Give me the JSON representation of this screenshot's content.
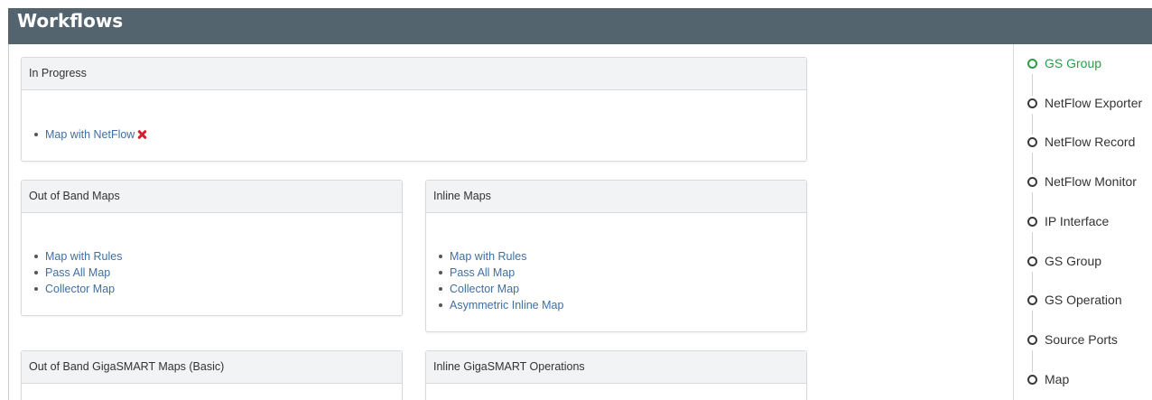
{
  "header": {
    "title": "Workflows"
  },
  "panels": {
    "in_progress": {
      "title": "In Progress",
      "items": [
        {
          "label": "Map with NetFlow",
          "removable": true
        }
      ]
    },
    "out_of_band_maps": {
      "title": "Out of Band Maps",
      "items": [
        {
          "label": "Map with Rules"
        },
        {
          "label": "Pass All Map"
        },
        {
          "label": "Collector Map"
        }
      ]
    },
    "inline_maps": {
      "title": "Inline Maps",
      "items": [
        {
          "label": "Map with Rules"
        },
        {
          "label": "Pass All Map"
        },
        {
          "label": "Collector Map"
        },
        {
          "label": "Asymmetric Inline Map"
        }
      ]
    },
    "out_of_band_gigasmart": {
      "title": "Out of Band GigaSMART Maps (Basic)"
    },
    "inline_gigasmart": {
      "title": "Inline GigaSMART Operations"
    }
  },
  "steps": [
    {
      "label": "GS Group",
      "active": true
    },
    {
      "label": "NetFlow Exporter"
    },
    {
      "label": "NetFlow Record"
    },
    {
      "label": "NetFlow Monitor"
    },
    {
      "label": "IP Interface"
    },
    {
      "label": "GS Group"
    },
    {
      "label": "GS Operation"
    },
    {
      "label": "Source Ports"
    },
    {
      "label": "Map"
    }
  ],
  "colors": {
    "header": "#54646f",
    "link": "#3f6fa3",
    "active_step": "#2e9b45",
    "remove": "#d0212d"
  },
  "icons": {
    "remove": "close-icon",
    "step_marker": "circle-icon"
  }
}
